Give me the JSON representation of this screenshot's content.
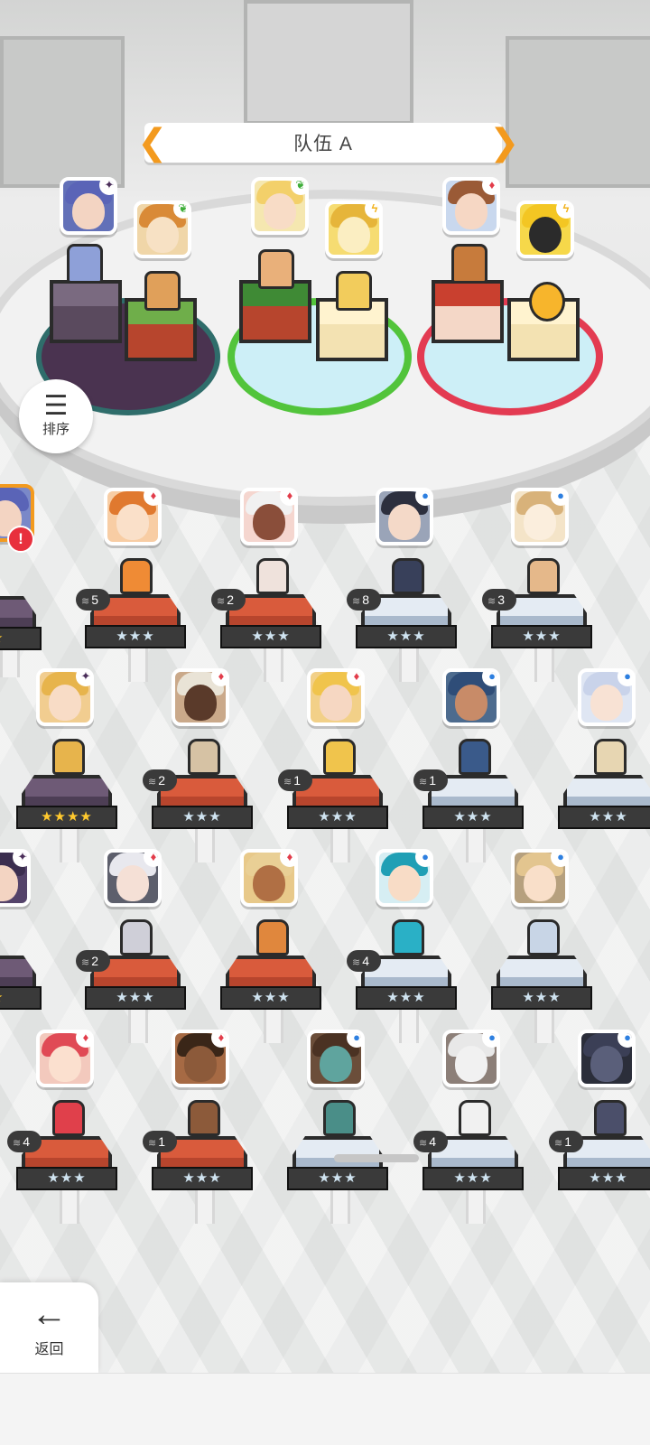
{
  "header": {
    "team_title": "队伍 A",
    "prev_arrow": "❮",
    "next_arrow": "❯"
  },
  "sort_button": {
    "icon": "sort-icon",
    "label": "排序"
  },
  "back_button": {
    "icon": "arrow-left-icon",
    "label": "返回"
  },
  "alert_badge": "!",
  "team": [
    {
      "element": "dark",
      "element_symbol": "✦"
    },
    {
      "element": "green",
      "element_symbol": "❦"
    },
    {
      "element": "green",
      "element_symbol": "❦"
    },
    {
      "element": "yellow",
      "element_symbol": "ϟ"
    },
    {
      "element": "red",
      "element_symbol": "♦"
    },
    {
      "element": "yellow",
      "element_symbol": "ϟ"
    }
  ],
  "roster": {
    "row1": [
      {
        "level": "",
        "stars": "★★",
        "element": "dark",
        "element_symbol": "✦",
        "base": "purple"
      },
      {
        "level": "5",
        "stars": "★★★",
        "element": "red",
        "element_symbol": "♦",
        "base": "red"
      },
      {
        "level": "2",
        "stars": "★★★",
        "element": "red",
        "element_symbol": "♦",
        "base": "red"
      },
      {
        "level": "8",
        "stars": "★★★",
        "element": "blue",
        "element_symbol": "●",
        "base": "blue"
      },
      {
        "level": "3",
        "stars": "★★★",
        "element": "blue",
        "element_symbol": "●",
        "base": "blue"
      }
    ],
    "row2": [
      {
        "level": "",
        "stars": "★★★★",
        "element": "dark",
        "element_symbol": "✦",
        "base": "purple"
      },
      {
        "level": "2",
        "stars": "★★★",
        "element": "red",
        "element_symbol": "♦",
        "base": "red"
      },
      {
        "level": "1",
        "stars": "★★★",
        "element": "red",
        "element_symbol": "♦",
        "base": "red"
      },
      {
        "level": "1",
        "stars": "★★★",
        "element": "blue",
        "element_symbol": "●",
        "base": "blue"
      },
      {
        "level": "",
        "stars": "★★★",
        "element": "blue",
        "element_symbol": "●",
        "base": "blue"
      }
    ],
    "row3": [
      {
        "level": "",
        "stars": "★★",
        "element": "dark",
        "element_symbol": "✦",
        "base": "purple"
      },
      {
        "level": "2",
        "stars": "★★★",
        "element": "red",
        "element_symbol": "♦",
        "base": "red"
      },
      {
        "level": "",
        "stars": "★★★",
        "element": "red",
        "element_symbol": "♦",
        "base": "red"
      },
      {
        "level": "4",
        "stars": "★★★",
        "element": "blue",
        "element_symbol": "●",
        "base": "blue"
      },
      {
        "level": "",
        "stars": "★★★",
        "element": "blue",
        "element_symbol": "●",
        "base": "blue"
      }
    ],
    "row4": [
      {
        "level": "4",
        "stars": "★★★",
        "element": "red",
        "element_symbol": "♦",
        "base": "red"
      },
      {
        "level": "1",
        "stars": "★★★",
        "element": "red",
        "element_symbol": "♦",
        "base": "red"
      },
      {
        "level": "",
        "stars": "★★★",
        "element": "blue",
        "element_symbol": "●",
        "base": "blue"
      },
      {
        "level": "4",
        "stars": "★★★",
        "element": "blue",
        "element_symbol": "●",
        "base": "blue"
      },
      {
        "level": "1",
        "stars": "★★★",
        "element": "blue",
        "element_symbol": "●",
        "base": "blue"
      }
    ]
  }
}
